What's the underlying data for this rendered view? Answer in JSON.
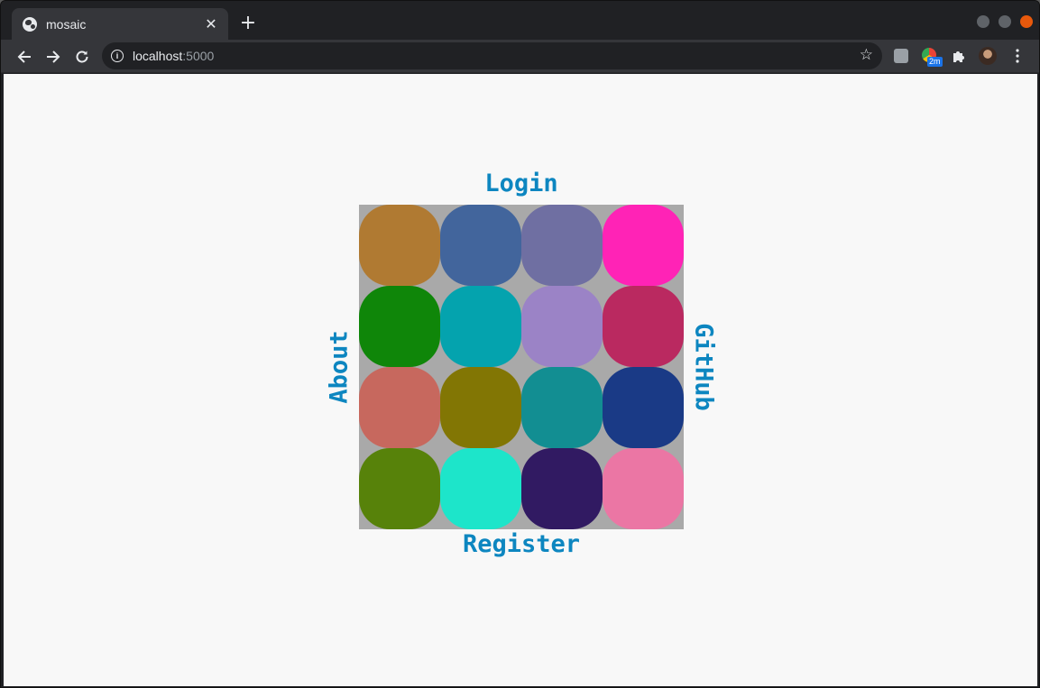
{
  "browser": {
    "tab_title": "mosaic",
    "tab_close": "✕",
    "new_tab": "+",
    "url_host": "localhost",
    "url_port": ":5000",
    "info_icon": "i",
    "star_icon": "☆",
    "extension_badge": "2m"
  },
  "mosaic": {
    "labels": {
      "top": "Login",
      "bottom": "Register",
      "left": "About",
      "right": "GitHub"
    },
    "tiles": [
      "#b07a32",
      "#42659c",
      "#6f6fa2",
      "#ff23b6",
      "#0f8609",
      "#04a3ae",
      "#9b83c6",
      "#ba2960",
      "#c7685e",
      "#827604",
      "#128e92",
      "#1a3a86",
      "#57820a",
      "#1de5ca",
      "#311a62",
      "#eb76a4"
    ]
  }
}
